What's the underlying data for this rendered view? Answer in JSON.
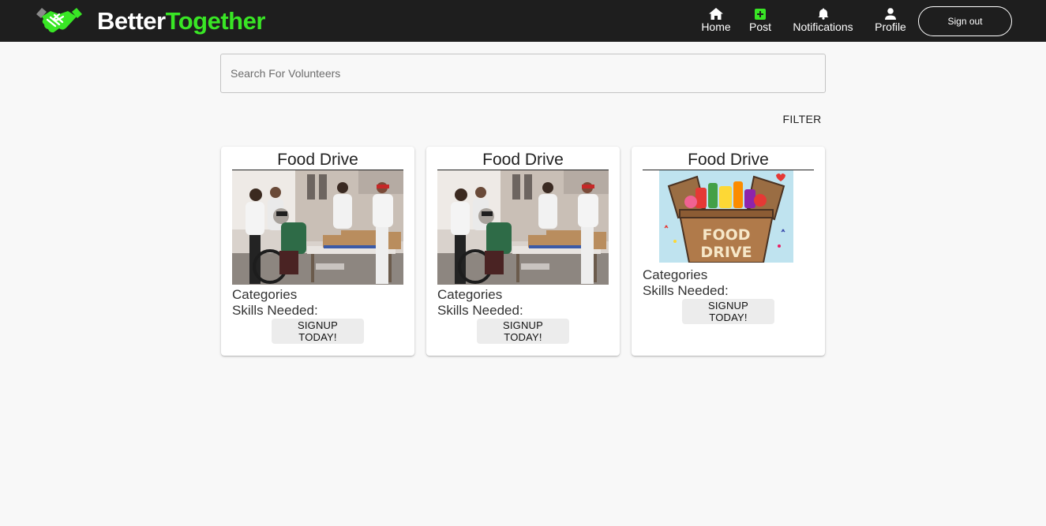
{
  "header": {
    "brand_part1": "Better",
    "brand_part2": "Together",
    "brand_colors": {
      "primary": "#ffffff",
      "accent": "#39e625"
    },
    "background": "#1e1e1e",
    "logo_icon": "handshake-icon",
    "nav": [
      {
        "label": "Home",
        "icon": "home-icon"
      },
      {
        "label": "Post",
        "icon": "plus-square-icon"
      },
      {
        "label": "Notifications",
        "icon": "bell-icon"
      },
      {
        "label": "Profile",
        "icon": "person-icon"
      }
    ],
    "signout_label": "Sign out"
  },
  "search": {
    "placeholder": "Search For Volunteers",
    "value": ""
  },
  "filter_label": "FILTER",
  "cards": [
    {
      "title": "Food Drive",
      "image": "volunteers-photo",
      "categories_label": "Categories",
      "skills_label": "Skills Needed:",
      "button_label": "SIGNUP TODAY!"
    },
    {
      "title": "Food Drive",
      "image": "volunteers-photo",
      "categories_label": "Categories",
      "skills_label": "Skills Needed:",
      "button_label": "SIGNUP TODAY!"
    },
    {
      "title": "Food Drive",
      "image": "food-drive-box-illustration",
      "image_text": "FOOD DRIVE",
      "categories_label": "Categories",
      "skills_label": "Skills Needed:",
      "button_label": "SIGNUP TODAY!"
    }
  ]
}
